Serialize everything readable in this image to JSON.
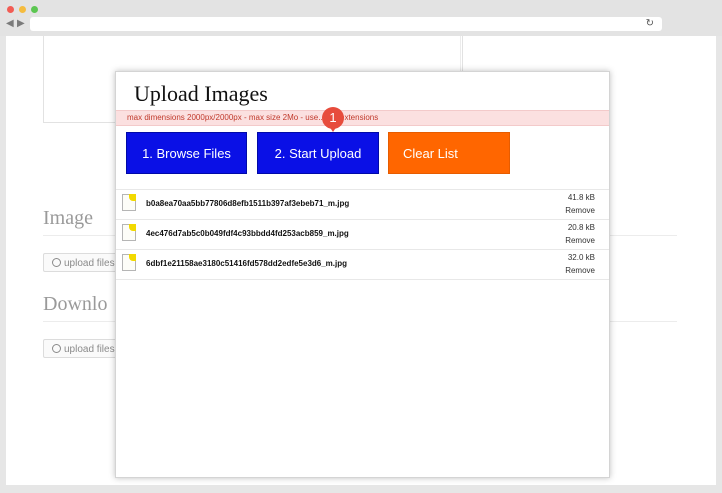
{
  "background": {
    "sections": [
      {
        "heading": "Image",
        "button": "upload files"
      },
      {
        "heading": "Downlo",
        "button": "upload files"
      }
    ]
  },
  "modal": {
    "title": "Upload Images",
    "notice": "max dimensions 2000px/2000px - max size 2Mo - use...ase extensions",
    "badge": "1",
    "buttons": {
      "browse": "1. Browse Files",
      "start": "2. Start Upload",
      "clear": "Clear List"
    },
    "files": [
      {
        "name": "b0a8ea70aa5bb77806d8efb1511b397af3ebeb71_m.jpg",
        "size": "41.8 kB",
        "remove": "Remove"
      },
      {
        "name": "4ec476d7ab5c0b049fdf4c93bbdd4fd253acb859_m.jpg",
        "size": "20.8 kB",
        "remove": "Remove"
      },
      {
        "name": "6dbf1e21158ae3180c51416fd578dd2edfe5e3d6_m.jpg",
        "size": "32.0 kB",
        "remove": "Remove"
      }
    ]
  },
  "colors": {
    "primary_button": "#0a10e6",
    "clear_button": "#ff6600",
    "notice_background": "#fbe0e0",
    "notice_text": "#c0392b",
    "badge": "#e74c3c"
  },
  "icons": [
    "back-arrow-icon",
    "forward-arrow-icon",
    "reload-icon",
    "upload-icon",
    "file-icon"
  ]
}
